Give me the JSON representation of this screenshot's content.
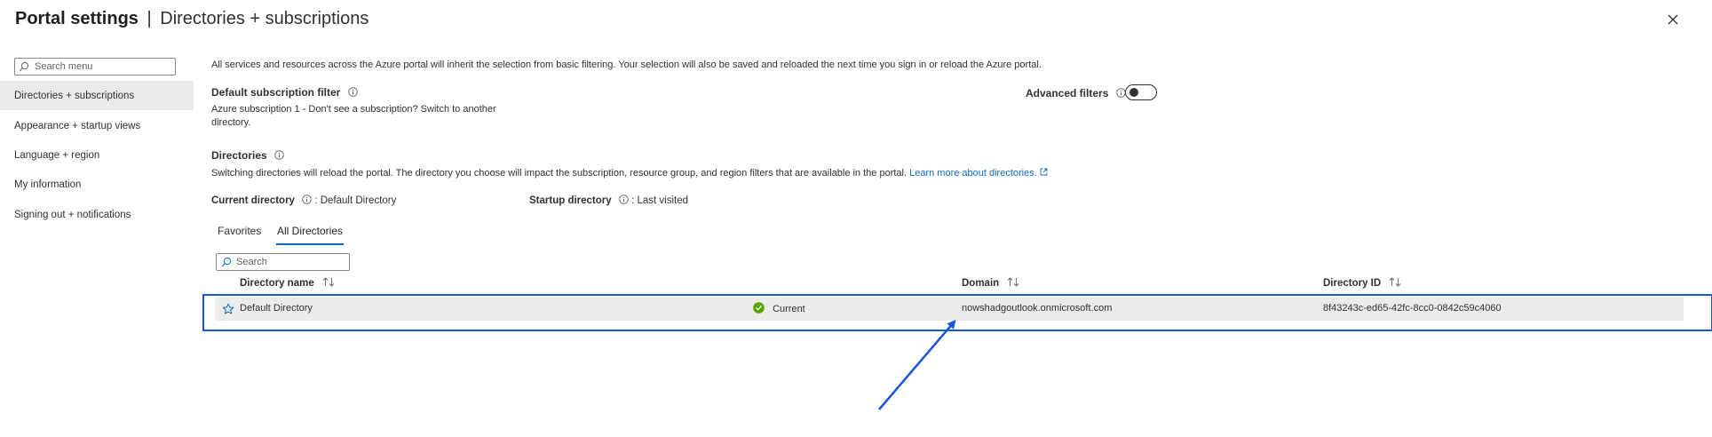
{
  "header": {
    "title": "Portal settings",
    "separator": "|",
    "subtitle": "Directories + subscriptions"
  },
  "sidebar": {
    "search_placeholder": "Search menu",
    "items": [
      {
        "label": "Directories + subscriptions",
        "active": true
      },
      {
        "label": "Appearance + startup views",
        "active": false
      },
      {
        "label": "Language + region",
        "active": false
      },
      {
        "label": "My information",
        "active": false
      },
      {
        "label": "Signing out + notifications",
        "active": false
      }
    ]
  },
  "main": {
    "intro": "All services and resources across the Azure portal will inherit the selection from basic filtering. Your selection will also be saved and reloaded the next time you sign in or reload the Azure portal.",
    "default_filter": {
      "label": "Default subscription filter",
      "value_line1": "Azure subscription 1 - Don't see a subscription? Switch to another",
      "value_line2": "directory."
    },
    "advanced_filters": {
      "label": "Advanced filters",
      "enabled": false
    },
    "directories": {
      "label": "Directories",
      "description": "Switching directories will reload the portal. The directory you choose will impact the subscription, resource group, and region filters that are available in the portal.",
      "learn_more": "Learn more about directories.",
      "current_label": "Current directory",
      "current_value": ": Default Directory",
      "startup_label": "Startup directory",
      "startup_value": ": Last visited"
    },
    "tabs": [
      {
        "label": "Favorites",
        "active": false
      },
      {
        "label": "All Directories",
        "active": true
      }
    ],
    "search_placeholder": "Search",
    "table": {
      "columns": [
        "Directory name",
        "Domain",
        "Directory ID"
      ],
      "rows": [
        {
          "name": "Default Directory",
          "status": "Current",
          "domain": "nowshadgoutlook.onmicrosoft.com",
          "directory_id": "8f43243c-ed65-42fc-8cc0-0842c59c4060"
        }
      ]
    }
  },
  "colors": {
    "accent": "#0f6cbd",
    "annotation": "#1a56db",
    "success": "#57a300",
    "selected_bg": "#edebe9"
  }
}
